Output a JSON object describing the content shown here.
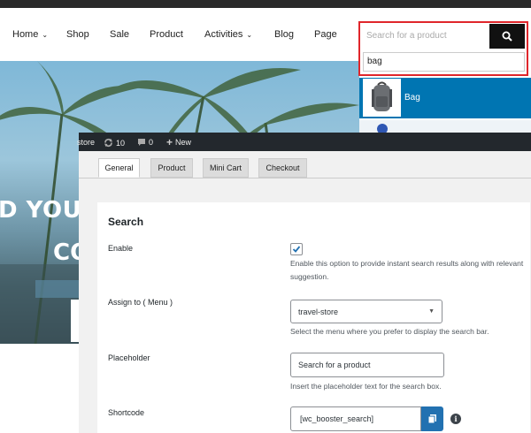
{
  "storefront": {
    "nav": {
      "home": "Home",
      "shop": "Shop",
      "sale": "Sale",
      "product": "Product",
      "activities": "Activities",
      "blog": "Blog",
      "page": "Page"
    },
    "hero": {
      "line1": "D YOUR S",
      "line2": "CO"
    }
  },
  "search_widget": {
    "placeholder": "Search for a product",
    "query": "bag",
    "results": [
      {
        "name": "Bag",
        "icon": "backpack-image"
      }
    ],
    "highlight_color": "#e0262b",
    "result_highlight_color": "#0075b2"
  },
  "admin_bar": {
    "site": "store",
    "updates_count": "10",
    "comments_count": "0",
    "new_label": "New"
  },
  "admin_panel": {
    "tabs": [
      "General",
      "Product",
      "Mini Cart",
      "Checkout"
    ],
    "active_tab": "General",
    "section_title": "Search",
    "fields": {
      "enable": {
        "label": "Enable",
        "checked": true,
        "description": "Enable this option to provide instant search results along with relevant suggestion."
      },
      "assign_menu": {
        "label": "Assign to ( Menu )",
        "value": "travel-store",
        "description": "Select the menu where you prefer to display the search bar."
      },
      "placeholder": {
        "label": "Placeholder",
        "value": "Search for a product",
        "description": "Insert the placeholder text for the search box."
      },
      "shortcode": {
        "label": "Shortcode",
        "value": "[wc_booster_search]"
      }
    }
  }
}
